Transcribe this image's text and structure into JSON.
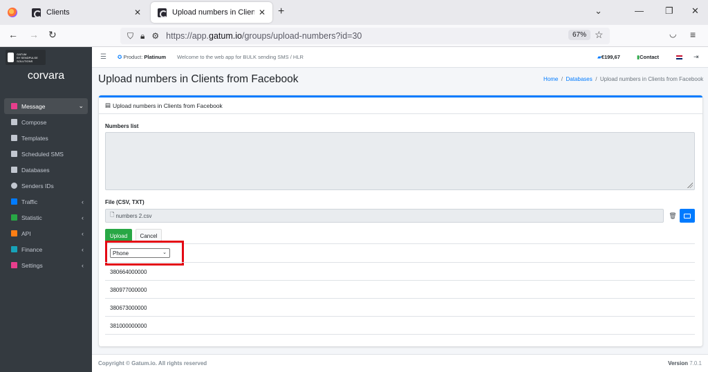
{
  "browser": {
    "tabs": [
      {
        "title": "Clients"
      },
      {
        "title": "Upload numbers in Clients from Facebook"
      }
    ],
    "url_prefix": "https://app.",
    "url_domain": "gatum.io",
    "url_path": "/groups/upload-numbers?id=30",
    "zoom": "67%"
  },
  "sidebar": {
    "brand_logo_text": "GATUM",
    "brand_logo_sub": "BY SENDPULSE SOLUTIONS",
    "brand_name": "corvara",
    "items": [
      {
        "label": "Message",
        "color": "#e83e8c"
      },
      {
        "label": "Compose",
        "color": "#c2c7d0"
      },
      {
        "label": "Templates",
        "color": "#c2c7d0"
      },
      {
        "label": "Scheduled SMS",
        "color": "#c2c7d0"
      },
      {
        "label": "Databases",
        "color": "#c2c7d0"
      },
      {
        "label": "Senders IDs",
        "color": "#c2c7d0"
      },
      {
        "label": "Traffic",
        "color": "#007bff"
      },
      {
        "label": "Statistic",
        "color": "#28a745"
      },
      {
        "label": "API",
        "color": "#fd7e14"
      },
      {
        "label": "Finance",
        "color": "#17a2b8"
      },
      {
        "label": "Settings",
        "color": "#e83e8c"
      }
    ]
  },
  "topnav": {
    "product_label": "Product:",
    "product_value": "Platinum",
    "welcome": "Welcome to the web app for BULK sending SMS / HLR",
    "balance": "€199,67",
    "contact": "Contact"
  },
  "page": {
    "title": "Upload numbers in Clients from Facebook",
    "breadcrumb": [
      "Home",
      "Databases",
      "Upload numbers in Clients from Facebook"
    ]
  },
  "card": {
    "header": "Upload numbers in Clients from Facebook",
    "numbers_label": "Numbers list",
    "file_label": "File (CSV, TXT)",
    "file_name": "numbers 2.csv",
    "upload_label": "Upload",
    "cancel_label": "Cancel",
    "column_select": "Phone",
    "rows": [
      "380664000000",
      "380977000000",
      "380673000000",
      "381000000000"
    ]
  },
  "footer": {
    "copyright": "Copyright © Gatum.io. All rights reserved",
    "version_label": "Version",
    "version": "7.0.1"
  }
}
